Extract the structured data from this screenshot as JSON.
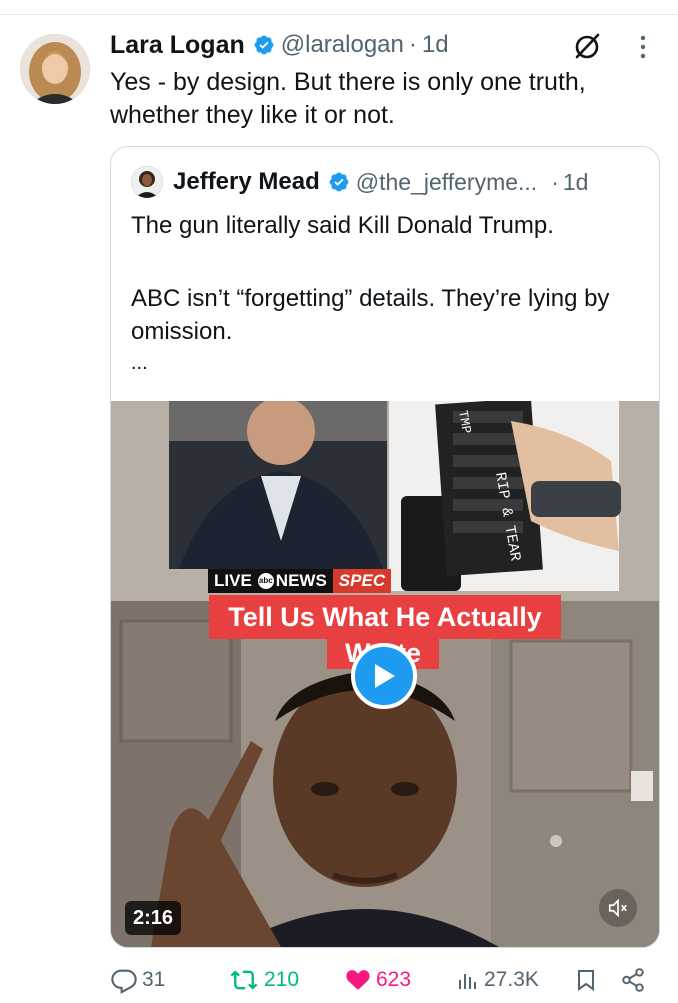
{
  "tweet": {
    "author_name": "Lara Logan",
    "handle": "@laralogan",
    "separator": "·",
    "time": "1d",
    "text": "Yes - by design. But there is only one truth, whether they like it or not."
  },
  "quoted": {
    "author_name": "Jeffery Mead",
    "handle": "@the_jefferyme...",
    "separator": "·",
    "time": "1d",
    "line1": "The gun literally said Kill Donald Trump.",
    "line2": "ABC  isn’t “forgetting” details. They’re lying by omission.",
    "ellipsis": "..."
  },
  "media": {
    "banner_live": "LIVE",
    "banner_network": "NEWS",
    "banner_logo": "abc",
    "banner_spec": "SPEC",
    "caption_line1": "Tell Us What He Actually",
    "caption_line2": "Wrote",
    "gun_text_1": "RIP & TEAR",
    "gun_text_2": "TMP",
    "duration": "2:16"
  },
  "actions": {
    "replies": "31",
    "reposts": "210",
    "likes": "623",
    "views": "27.3K"
  },
  "colors": {
    "brand_blue": "#1d9bf0",
    "repost_green": "#00ba7c",
    "like_pink": "#f91880",
    "secondary_text": "#536471",
    "caption_red": "#e84040"
  },
  "icons": [
    "verified-badge-icon",
    "grok-icon",
    "more-icon",
    "play-icon",
    "mute-icon",
    "reply-icon",
    "repost-icon",
    "like-icon",
    "views-icon",
    "bookmark-icon",
    "share-icon"
  ]
}
